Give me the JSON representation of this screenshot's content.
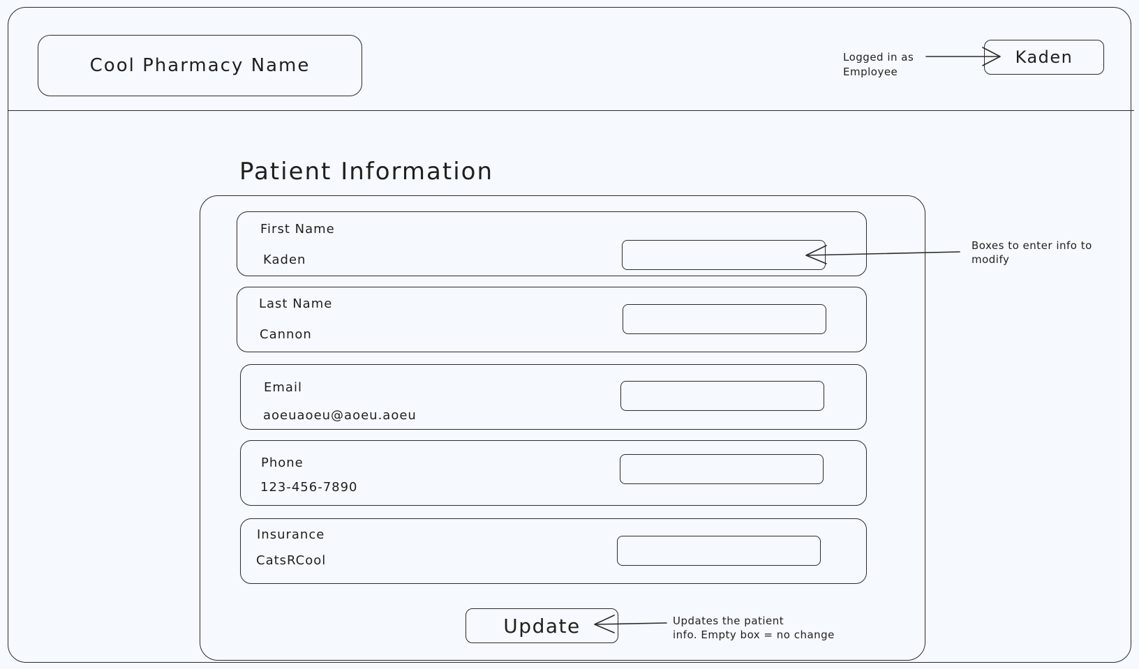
{
  "header": {
    "brand": "Cool Pharmacy Name",
    "login_note_line1": "Logged in as",
    "login_note_line2": "Employee",
    "user": "Kaden"
  },
  "main": {
    "title": "Patient Information",
    "fields": [
      {
        "label": "First Name",
        "value": "Kaden",
        "input_value": ""
      },
      {
        "label": "Last Name",
        "value": "Cannon",
        "input_value": ""
      },
      {
        "label": "Email",
        "value": "aoeuaoeu@aoeu.aoeu",
        "input_value": ""
      },
      {
        "label": "Phone",
        "value": "123-456-7890",
        "input_value": ""
      },
      {
        "label": "Insurance",
        "value": "CatsRCool",
        "input_value": ""
      }
    ],
    "update_label": "Update"
  },
  "annotations": {
    "boxes_note_line1": "Boxes to enter info to",
    "boxes_note_line2": "modify",
    "update_note_line1": "Updates the patient",
    "update_note_line2": "info. Empty box = no change"
  },
  "colors": {
    "background": "#f6f9fd",
    "stroke": "#2a2a2a",
    "text": "#1f1f1f"
  }
}
